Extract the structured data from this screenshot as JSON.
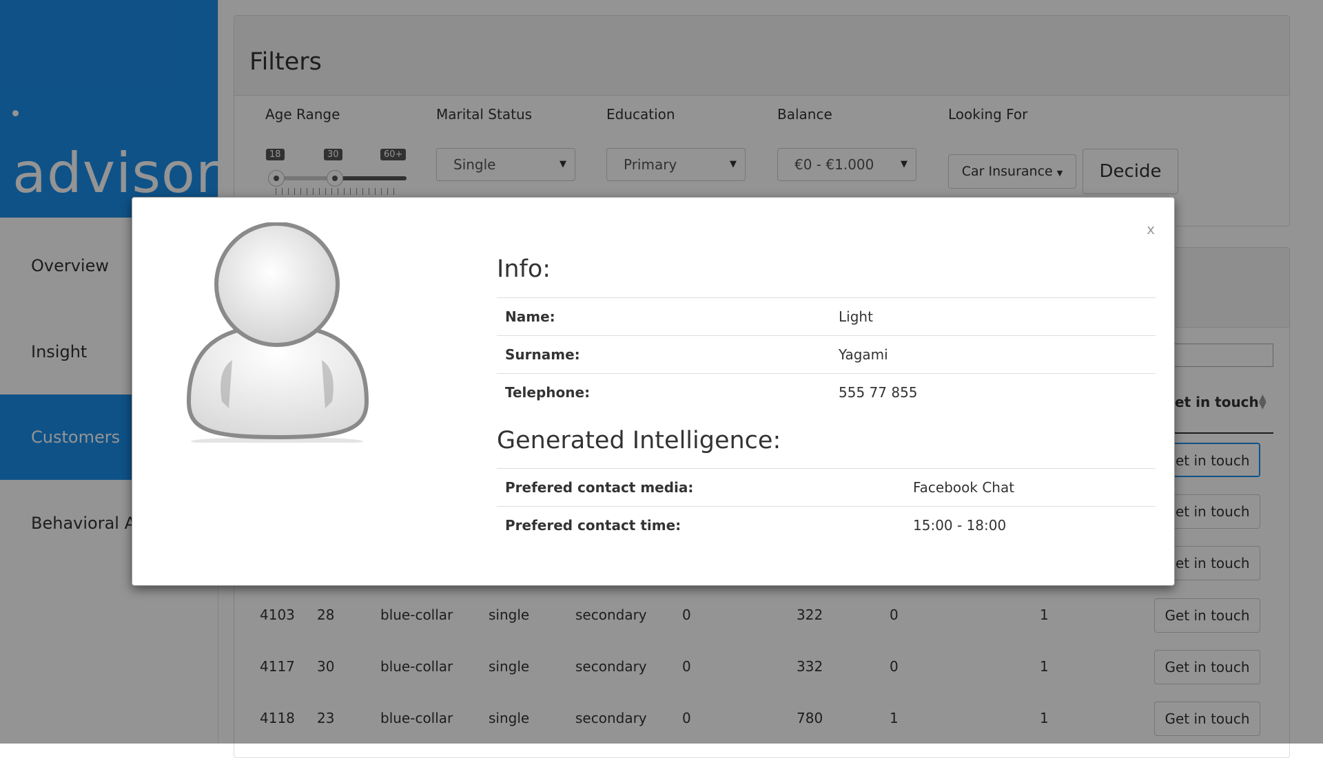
{
  "sidebar": {
    "logo": "advisor",
    "items": [
      {
        "label": "Overview",
        "active": false
      },
      {
        "label": "Insight",
        "active": false
      },
      {
        "label": "Customers",
        "active": true
      },
      {
        "label": "Behavioral A",
        "active": false
      }
    ]
  },
  "filters": {
    "title": "Filters",
    "age_range": {
      "label": "Age Range",
      "min": "18",
      "value": "30",
      "max": "60+",
      "range_fraction": [
        0.0,
        0.29
      ]
    },
    "marital_status": {
      "label": "Marital Status",
      "value": "Single"
    },
    "education": {
      "label": "Education",
      "value": "Primary"
    },
    "balance": {
      "label": "Balance",
      "value": "€0 - €1.000"
    },
    "looking_for": {
      "label": "Looking For",
      "value": "Car Insurance"
    },
    "decide_label": "Decide"
  },
  "table": {
    "column_get_in_touch": "et in touch",
    "button_label": "Get in touch",
    "partial_button_label": "Get in touch",
    "rows": [
      [
        "4103",
        "28",
        "blue-collar",
        "single",
        "secondary",
        "0",
        "322",
        "0",
        "1"
      ],
      [
        "4117",
        "30",
        "blue-collar",
        "single",
        "secondary",
        "0",
        "332",
        "0",
        "1"
      ],
      [
        "4118",
        "23",
        "blue-collar",
        "single",
        "secondary",
        "0",
        "780",
        "1",
        "1"
      ]
    ]
  },
  "modal": {
    "close_label": "x",
    "info_title": "Info:",
    "info": [
      {
        "key": "Name:",
        "value": "Light"
      },
      {
        "key": "Surname:",
        "value": "Yagami"
      },
      {
        "key": "Telephone:",
        "value": "555 77 855"
      }
    ],
    "intel_title": "Generated Intelligence:",
    "intel": [
      {
        "key": "Prefered contact media:",
        "value": "Facebook Chat"
      },
      {
        "key": "Prefered contact time:",
        "value": "15:00 - 18:00"
      }
    ]
  },
  "colors": {
    "brand": "#1b8ee8",
    "overlay": "rgba(0,0,0,0.42)"
  }
}
